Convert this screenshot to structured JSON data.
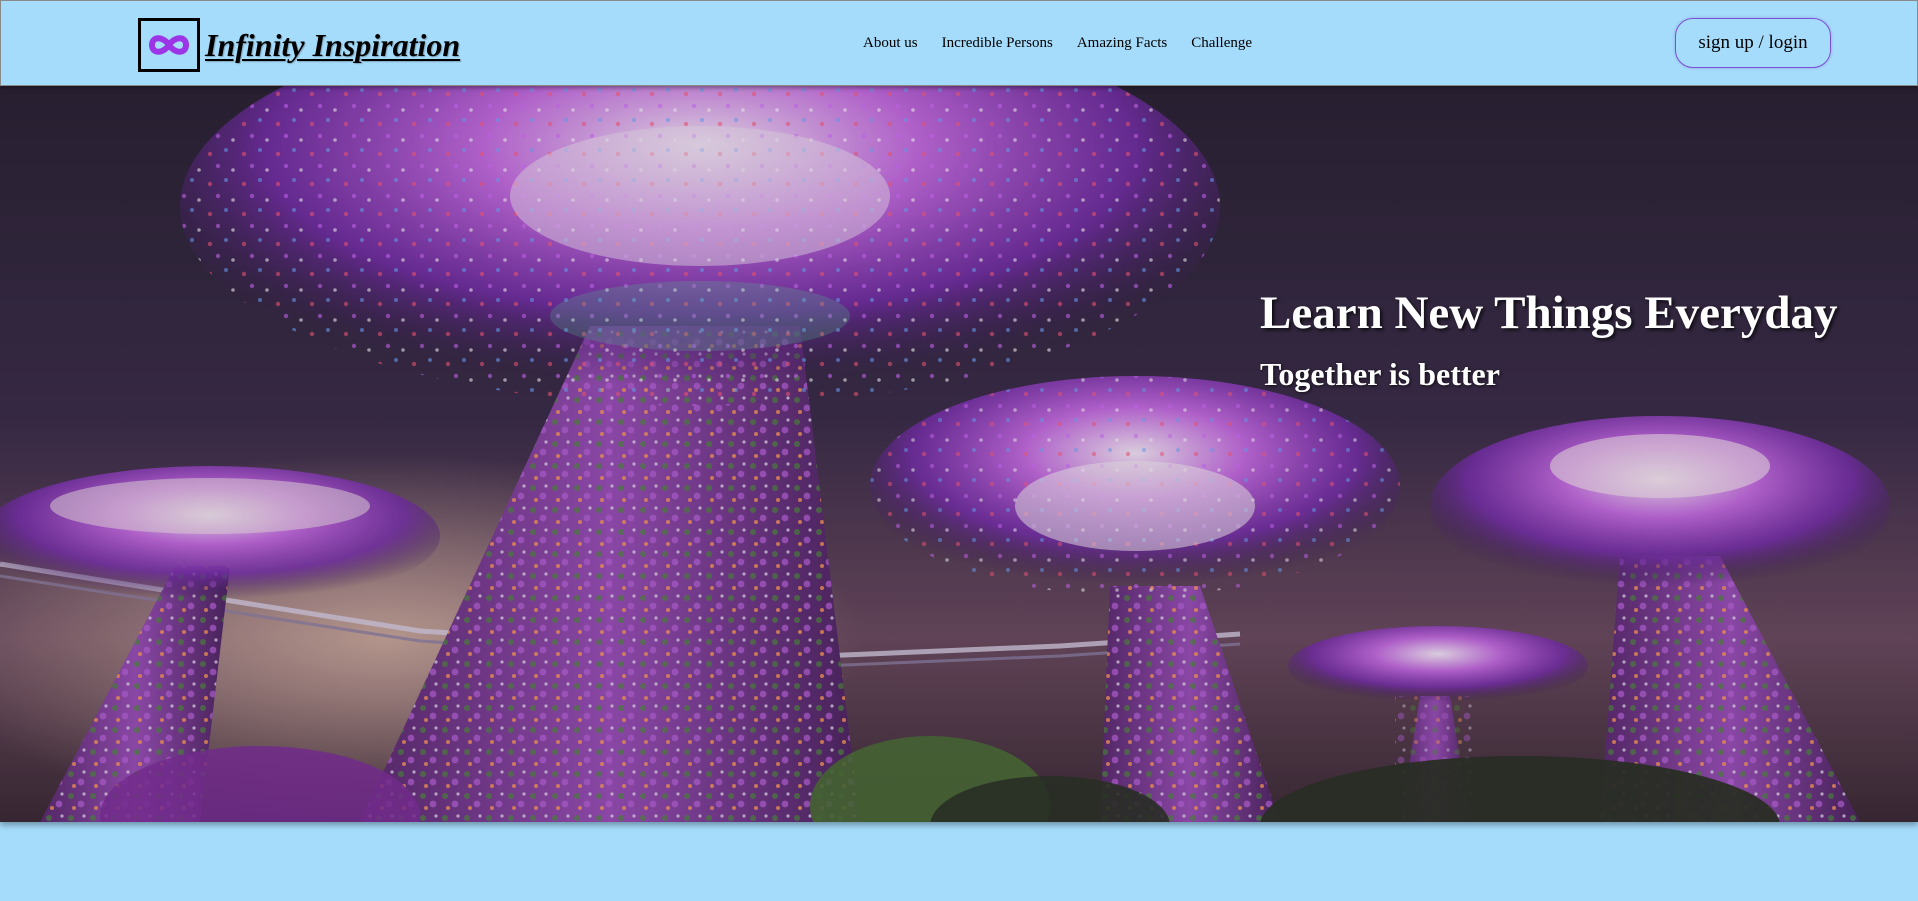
{
  "header": {
    "logo_icon": "infinity-icon",
    "brand_name": "Infinity Inspiration",
    "nav": [
      {
        "label": "About us"
      },
      {
        "label": "Incredible Persons"
      },
      {
        "label": "Amazing Facts"
      },
      {
        "label": "Challenge"
      }
    ],
    "auth_label": "sign up / login"
  },
  "hero": {
    "image": "supertrees-night-photo",
    "title": "Learn New Things Everyday",
    "subtitle": "Together is better"
  },
  "colors": {
    "page_background": "#a6dcfb",
    "logo_accent": "#9b35e6",
    "button_border": "#7a4fd0"
  }
}
